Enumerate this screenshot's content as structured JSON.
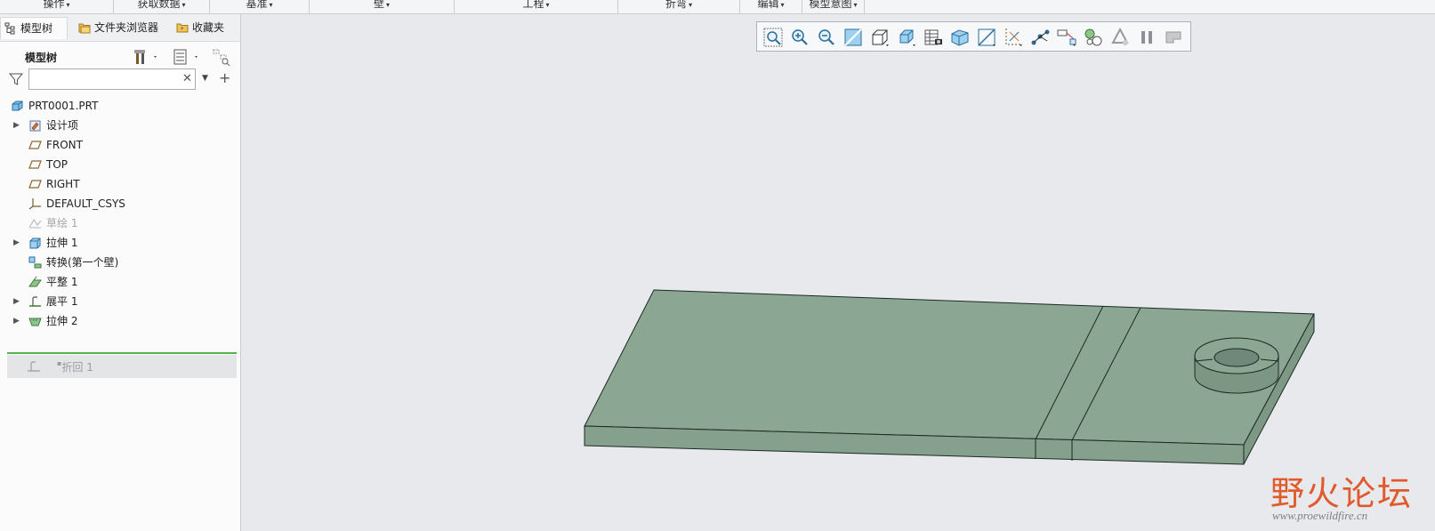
{
  "ribbon": {
    "groups": [
      {
        "label": "操作"
      },
      {
        "label": "获取数据"
      },
      {
        "label": "基准"
      },
      {
        "label": "壁"
      },
      {
        "label": "工程"
      },
      {
        "label": "折弯"
      },
      {
        "label": "编辑"
      },
      {
        "label": "模型意图"
      }
    ]
  },
  "left_panel": {
    "tabs": [
      {
        "label": "模型树",
        "icon": "model-tree-icon",
        "active": true
      },
      {
        "label": "文件夹浏览器",
        "icon": "folder-icon",
        "active": false
      },
      {
        "label": "收藏夹",
        "icon": "favorites-icon",
        "active": false
      }
    ],
    "tree_header": {
      "title": "模型树"
    },
    "filter": {
      "value": "",
      "placeholder": ""
    },
    "tree": [
      {
        "label": "PRT0001.PRT",
        "icon": "part-icon",
        "expandable": false,
        "dim": false
      },
      {
        "label": "设计项",
        "icon": "design-items-icon",
        "expandable": true,
        "dim": false
      },
      {
        "label": "FRONT",
        "icon": "datum-plane-icon",
        "expandable": false,
        "dim": false
      },
      {
        "label": "TOP",
        "icon": "datum-plane-icon",
        "expandable": false,
        "dim": false
      },
      {
        "label": "RIGHT",
        "icon": "datum-plane-icon",
        "expandable": false,
        "dim": false
      },
      {
        "label": "DEFAULT_CSYS",
        "icon": "csys-icon",
        "expandable": false,
        "dim": false
      },
      {
        "label": "草绘 1",
        "icon": "sketch-icon",
        "expandable": false,
        "dim": true
      },
      {
        "label": "拉伸 1",
        "icon": "extrude-icon",
        "expandable": true,
        "dim": false
      },
      {
        "label": "转换(第一个壁)",
        "icon": "convert-icon",
        "expandable": false,
        "dim": false
      },
      {
        "label": "平整 1",
        "icon": "flat-wall-icon",
        "expandable": false,
        "dim": false
      },
      {
        "label": "展平 1",
        "icon": "unbend-icon",
        "expandable": true,
        "dim": false
      },
      {
        "label": "拉伸 2",
        "icon": "extrude-cut-icon",
        "expandable": true,
        "dim": false
      }
    ],
    "insert_row": {
      "label": "折回 1",
      "marker": "▪"
    }
  },
  "graphics_toolbar": {
    "buttons": [
      "zoom-fit-icon",
      "zoom-in-icon",
      "zoom-out-icon",
      "repaint-icon",
      "view-orient-icon",
      "saved-views-icon",
      "display-style-icon",
      "perspective-icon",
      "section-icon",
      "datum-display-icon",
      "spin-center-icon",
      "annotation-display-icon",
      "appearance-icon",
      "recycle-icon",
      "pause-icon",
      "stop-icon"
    ]
  },
  "watermark": {
    "text": "野火论坛",
    "url": "www.proewildfire.cn"
  },
  "colors": {
    "model_face": "#8ba693",
    "model_edge": "#1b2a22",
    "viewport_bg": "#e7e9ed",
    "active_separator": "#4cb648",
    "watermark": "#e05a2b"
  }
}
